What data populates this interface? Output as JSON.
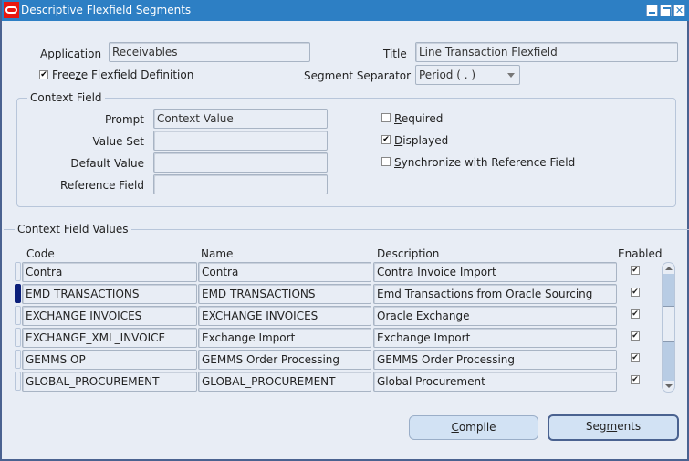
{
  "window": {
    "title": "Descriptive Flexfield Segments",
    "controls": [
      "minimize",
      "maximize",
      "close"
    ]
  },
  "header": {
    "application_label": "Application",
    "application_value": "Receivables",
    "title_label": "Title",
    "title_value": "Line Transaction Flexfield",
    "freeze_label_pre": "Free",
    "freeze_label_ul": "z",
    "freeze_label_post": "e Flexfield Definition",
    "freeze_checked": true,
    "separator_label": "Segment Separator",
    "separator_value": "Period ( . )"
  },
  "context_field": {
    "group_title": "Context Field",
    "prompt_label": "Prompt",
    "prompt_value": "Context Value",
    "value_set_label": "Value Set",
    "value_set_value": "",
    "default_value_label": "Default Value",
    "default_value_value": "",
    "reference_field_label": "Reference Field",
    "reference_field_value": "",
    "required": {
      "ul": "R",
      "rest": "equired",
      "checked": false
    },
    "displayed": {
      "ul": "D",
      "rest": "isplayed",
      "checked": true
    },
    "synchronize": {
      "ul": "S",
      "rest": "ynchronize with Reference Field",
      "checked": false
    }
  },
  "context_values": {
    "group_title": "Context Field Values",
    "columns": {
      "code": "Code",
      "name": "Name",
      "description": "Description",
      "enabled": "Enabled"
    },
    "rows": [
      {
        "code": "Contra",
        "name": "Contra",
        "description": "Contra Invoice Import",
        "enabled": true,
        "current": false
      },
      {
        "code": "EMD TRANSACTIONS",
        "name": "EMD TRANSACTIONS",
        "description": "Emd Transactions from Oracle Sourcing",
        "enabled": true,
        "current": true
      },
      {
        "code": "EXCHANGE INVOICES",
        "name": "EXCHANGE INVOICES",
        "description": "Oracle Exchange",
        "enabled": true,
        "current": false
      },
      {
        "code": "EXCHANGE_XML_INVOICE",
        "name": "Exchange Import",
        "description": "Exchange Import",
        "enabled": true,
        "current": false
      },
      {
        "code": "GEMMS OP",
        "name": "GEMMS Order Processing",
        "description": "GEMMS Order Processing",
        "enabled": true,
        "current": false
      },
      {
        "code": "GLOBAL_PROCUREMENT",
        "name": "GLOBAL_PROCUREMENT",
        "description": "Global Procurement",
        "enabled": true,
        "current": false
      }
    ]
  },
  "buttons": {
    "compile": {
      "ul": "C",
      "rest": "ompile"
    },
    "segments": {
      "pre": "Seg",
      "ul": "m",
      "post": "ents"
    }
  },
  "icons": {
    "check": "✔",
    "close": "✕"
  }
}
